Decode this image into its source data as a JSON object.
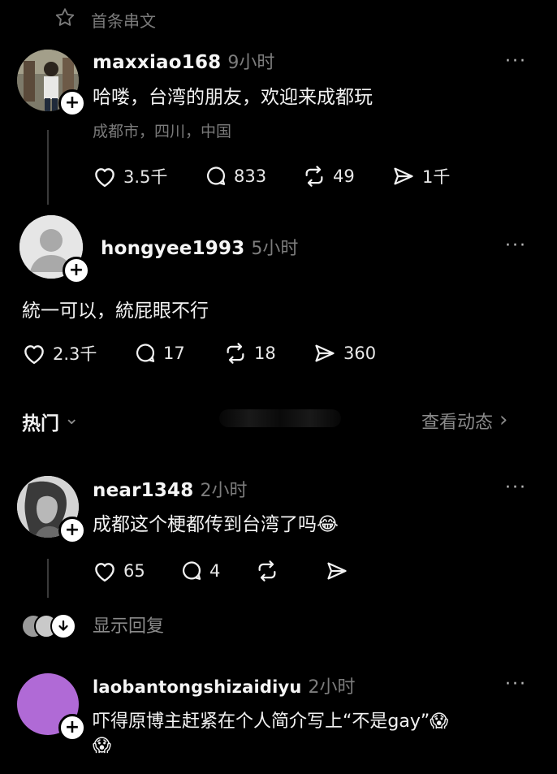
{
  "header": {
    "label": "首条串文"
  },
  "posts": [
    {
      "username": "maxxiao168",
      "time": "9小时",
      "text": "哈喽，台湾的朋友，欢迎来成都玩",
      "location": "成都市，四川，中国",
      "likes": "3.5千",
      "comments": "833",
      "reposts": "49",
      "shares": "1千",
      "more": "···"
    },
    {
      "username": "hongyee1993",
      "time": "5小时",
      "text": "統一可以，統屁眼不行",
      "likes": "2.3千",
      "comments": "17",
      "reposts": "18",
      "shares": "360",
      "more": "···"
    }
  ],
  "section": {
    "title": "热门",
    "chevron": "⌄",
    "view_activity": "查看动态",
    "arrow": "›"
  },
  "replies": [
    {
      "username": "near1348",
      "time": "2小时",
      "text": "成都这个梗都传到台湾了吗😂",
      "likes": "65",
      "comments": "4",
      "more": "···"
    },
    {
      "username": "laobantongshizaidiyu",
      "time": "2小时",
      "text_line1": "吓得原博主赶紧在个人简介写上“不是gay”😱",
      "text_line2": "😱",
      "more": "···"
    }
  ],
  "show_replies": {
    "label": "显示回复"
  },
  "colors": {
    "background": "#000000",
    "text": "#f2f2f2",
    "muted": "#7a7a7a",
    "avatar_purple": "#b06ad6"
  }
}
